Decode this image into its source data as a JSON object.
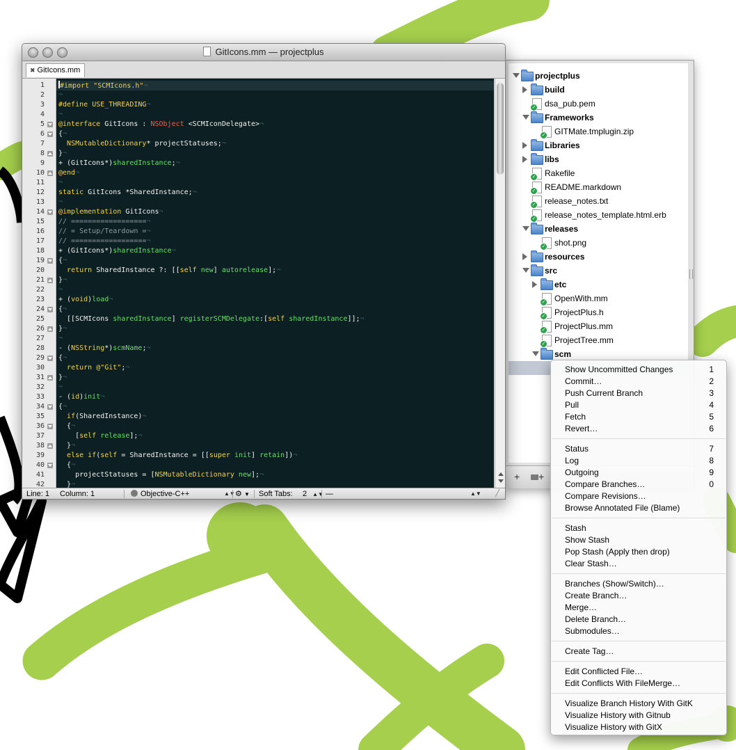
{
  "colors": {
    "wallpaper_green": "#a5cf4c",
    "editor_bg": "#0c1f22",
    "keyword": "#f6d24a",
    "class_red": "#ff5a4a",
    "method_green": "#67e06a"
  },
  "window": {
    "title": "GitIcons.mm — projectplus",
    "tab_label": "GitIcons.mm",
    "tab_close_icon": "close-icon"
  },
  "editor": {
    "line_numbers": [
      "1",
      "2",
      "3",
      "4",
      "5",
      "6",
      "7",
      "8",
      "9",
      "10",
      "11",
      "12",
      "13",
      "14",
      "15",
      "16",
      "17",
      "18",
      "19",
      "20",
      "21",
      "22",
      "23",
      "24",
      "25",
      "26",
      "27",
      "28",
      "29",
      "30",
      "31",
      "32",
      "33",
      "34",
      "35",
      "36",
      "37",
      "38",
      "39",
      "40",
      "41",
      "42"
    ],
    "lines": [
      "#import \"SCMIcons.h\"",
      "",
      "#define USE_THREADING",
      "",
      "@interface GitIcons : NSObject <SCMIconDelegate>",
      "{",
      "  NSMutableDictionary* projectStatuses;",
      "}",
      "+ (GitIcons*)sharedInstance;",
      "@end",
      "",
      "static GitIcons *SharedInstance;",
      "",
      "@implementation GitIcons",
      "// ==================",
      "// = Setup/Teardown =",
      "// ==================",
      "+ (GitIcons*)sharedInstance",
      "{",
      "  return SharedInstance ?: [[self new] autorelease];",
      "}",
      "",
      "+ (void)load",
      "{",
      "  [[SCMIcons sharedInstance] registerSCMDelegate:[self sharedInstance]];",
      "}",
      "",
      "- (NSString*)scmName;",
      "{",
      "  return @\"Git\";",
      "}",
      "",
      "- (id)init",
      "{",
      "  if(SharedInstance)",
      "  {",
      "    [self release];",
      "  }",
      "  else if(self = SharedInstance = [[super init] retain])",
      "  {",
      "    projectStatuses = [NSMutableDictionary new];",
      "  }"
    ]
  },
  "statusbar": {
    "line": "Line: 1",
    "column": "Column: 1",
    "language": "Objective-C++",
    "soft_tabs_label": "Soft Tabs:",
    "soft_tabs_value": "2",
    "symbol": "—"
  },
  "drawer": {
    "items": [
      {
        "label": "projectplus",
        "kind": "folder",
        "disclosure": "open"
      },
      {
        "label": "build",
        "kind": "folder",
        "disclosure": "closed"
      },
      {
        "label": "dsa_pub.pem",
        "kind": "file"
      },
      {
        "label": "Frameworks",
        "kind": "folder",
        "disclosure": "open"
      },
      {
        "label": "GITMate.tmplugin.zip",
        "kind": "file"
      },
      {
        "label": "Libraries",
        "kind": "folder",
        "disclosure": "closed"
      },
      {
        "label": "libs",
        "kind": "folder",
        "disclosure": "closed"
      },
      {
        "label": "Rakefile",
        "kind": "file"
      },
      {
        "label": "README.markdown",
        "kind": "file"
      },
      {
        "label": "release_notes.txt",
        "kind": "file"
      },
      {
        "label": "release_notes_template.html.erb",
        "kind": "file"
      },
      {
        "label": "releases",
        "kind": "folder",
        "disclosure": "open"
      },
      {
        "label": "shot.png",
        "kind": "file"
      },
      {
        "label": "resources",
        "kind": "folder",
        "disclosure": "closed"
      },
      {
        "label": "src",
        "kind": "folder",
        "disclosure": "open"
      },
      {
        "label": "etc",
        "kind": "folder",
        "disclosure": "closed"
      },
      {
        "label": "OpenWith.mm",
        "kind": "file"
      },
      {
        "label": "ProjectPlus.h",
        "kind": "file"
      },
      {
        "label": "ProjectPlus.mm",
        "kind": "file"
      },
      {
        "label": "ProjectTree.mm",
        "kind": "file"
      },
      {
        "label": "scm",
        "kind": "folder",
        "disclosure": "open"
      }
    ],
    "add_button": "+",
    "add_folder_button": "+"
  },
  "context_menu": {
    "groups": [
      [
        {
          "label": "Show Uncommitted Changes",
          "shortcut": "1"
        },
        {
          "label": "Commit…",
          "shortcut": "2"
        },
        {
          "label": "Push Current Branch",
          "shortcut": "3"
        },
        {
          "label": "Pull",
          "shortcut": "4"
        },
        {
          "label": "Fetch",
          "shortcut": "5"
        },
        {
          "label": "Revert…",
          "shortcut": "6"
        }
      ],
      [
        {
          "label": "Status",
          "shortcut": "7"
        },
        {
          "label": "Log",
          "shortcut": "8"
        },
        {
          "label": "Outgoing",
          "shortcut": "9"
        },
        {
          "label": "Compare Branches…",
          "shortcut": "0"
        },
        {
          "label": "Compare Revisions…",
          "shortcut": ""
        },
        {
          "label": "Browse Annotated File (Blame)",
          "shortcut": ""
        }
      ],
      [
        {
          "label": "Stash",
          "shortcut": ""
        },
        {
          "label": "Show Stash",
          "shortcut": ""
        },
        {
          "label": "Pop Stash (Apply then drop)",
          "shortcut": ""
        },
        {
          "label": "Clear Stash…",
          "shortcut": ""
        }
      ],
      [
        {
          "label": "Branches (Show/Switch)…",
          "shortcut": ""
        },
        {
          "label": "Create Branch…",
          "shortcut": ""
        },
        {
          "label": "Merge…",
          "shortcut": ""
        },
        {
          "label": "Delete Branch…",
          "shortcut": ""
        },
        {
          "label": "Submodules…",
          "shortcut": ""
        }
      ],
      [
        {
          "label": "Create Tag…",
          "shortcut": ""
        }
      ],
      [
        {
          "label": "Edit Conflicted File…",
          "shortcut": ""
        },
        {
          "label": "Edit Conflicts With FileMerge…",
          "shortcut": ""
        }
      ],
      [
        {
          "label": "Visualize Branch History With GitK",
          "shortcut": ""
        },
        {
          "label": "Visualize History with Gitnub",
          "shortcut": ""
        },
        {
          "label": "Visualize History with GitX",
          "shortcut": ""
        }
      ]
    ]
  }
}
